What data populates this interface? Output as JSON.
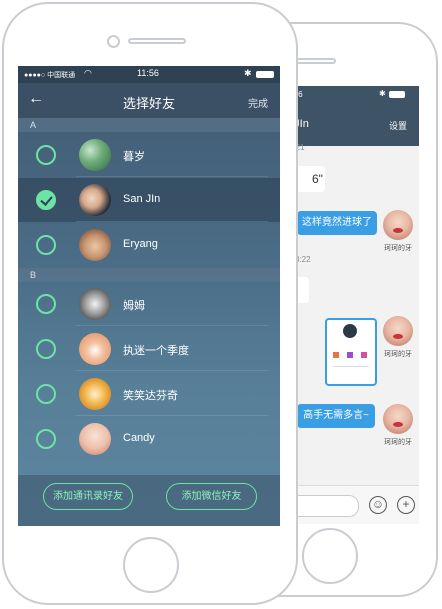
{
  "front": {
    "status": {
      "carrier": "●●●●○ 中国联通",
      "time": "11:56",
      "bluetooth": "✱"
    },
    "nav": {
      "back_icon": "←",
      "title": "选择好友",
      "done": "完成"
    },
    "sections": [
      "A",
      "B"
    ],
    "contacts": [
      {
        "name": "暮岁",
        "selected": false,
        "avatar": "avatar-green-dress"
      },
      {
        "name": "San JIn",
        "selected": true,
        "avatar": "avatar-dark-hair-woman"
      },
      {
        "name": "Eryang",
        "selected": false,
        "avatar": "avatar-man"
      },
      {
        "name": "姆姆",
        "selected": false,
        "avatar": "avatar-bw-man"
      },
      {
        "name": "执迷一个季度",
        "selected": false,
        "avatar": "avatar-laughing"
      },
      {
        "name": "笑笑达芬奇",
        "selected": false,
        "avatar": "avatar-food"
      },
      {
        "name": "Candy",
        "selected": false,
        "avatar": "avatar-doll"
      }
    ],
    "buttons": {
      "add_contacts": "添加通讯录好友",
      "add_wechat": "添加微信好友"
    },
    "accent": "#6ee3a6"
  },
  "back": {
    "status": {
      "time": "1:56"
    },
    "nav": {
      "title": "n JIn",
      "settings": "设置"
    },
    "messages": [
      {
        "time": "8:21"
      },
      {
        "text": "6\"",
        "side": "in"
      },
      {
        "text": "这样竟然进球了",
        "side": "out",
        "name": "珂珂的牙"
      },
      {
        "time": "8:22"
      },
      {
        "side": "out",
        "name": "珂珂的牙",
        "card": true
      },
      {
        "text": "高手无需多言~",
        "side": "out",
        "name": "珂珂的牙"
      }
    ],
    "bar_color": "#3e5366"
  }
}
